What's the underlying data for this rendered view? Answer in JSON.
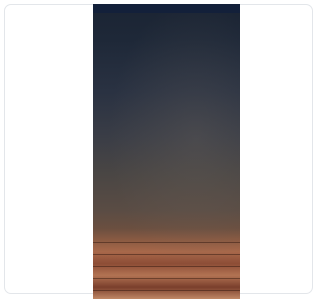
{
  "navbar": {
    "logo": "",
    "items": [
      "",
      "",
      "",
      "",
      "",
      ""
    ]
  },
  "hero": {
    "line1": "",
    "line2": ""
  },
  "colors": {
    "navbar": "#13203a",
    "hero_text": "#f3f0ea",
    "card_border": "#e3e6ea"
  }
}
